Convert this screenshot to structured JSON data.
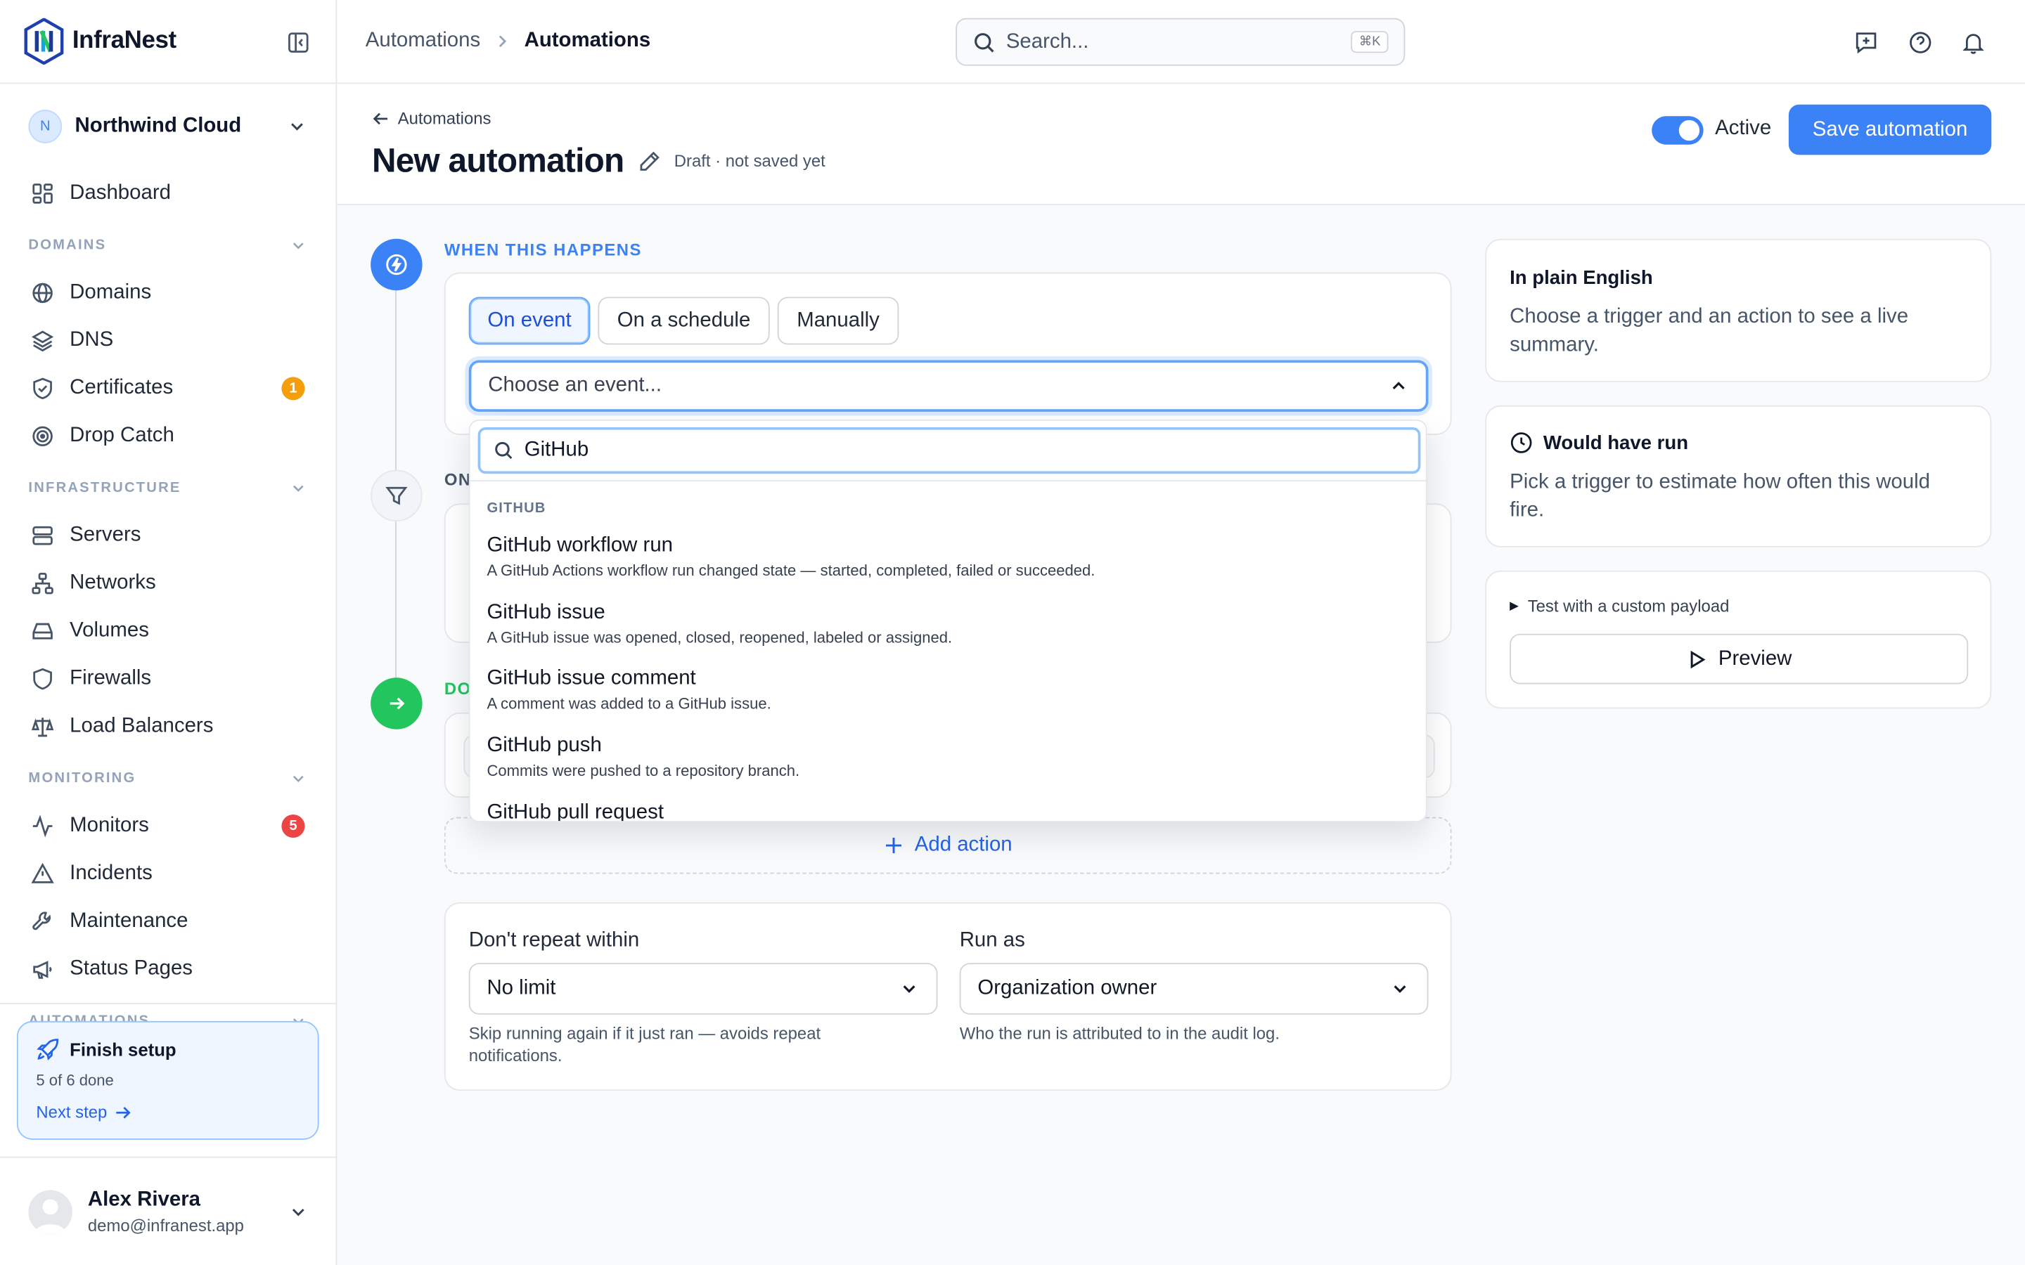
{
  "app": {
    "name": "InfraNest"
  },
  "org": {
    "initial": "N",
    "name": "Northwind Cloud"
  },
  "nav": {
    "dashboard": "Dashboard",
    "sections": {
      "domains": "DOMAINS",
      "infrastructure": "INFRASTRUCTURE",
      "monitoring": "MONITORING",
      "automations": "AUTOMATIONS"
    },
    "items": {
      "domains": "Domains",
      "dns": "DNS",
      "certificates": "Certificates",
      "certificates_badge": "1",
      "drop_catch": "Drop Catch",
      "servers": "Servers",
      "networks": "Networks",
      "volumes": "Volumes",
      "firewalls": "Firewalls",
      "load_balancers": "Load Balancers",
      "monitors": "Monitors",
      "monitors_badge": "5",
      "incidents": "Incidents",
      "maintenance": "Maintenance",
      "status_pages": "Status Pages"
    }
  },
  "setup": {
    "title": "Finish setup",
    "progress": "5 of 6 done",
    "next": "Next step"
  },
  "user": {
    "name": "Alex Rivera",
    "email": "demo@infranest.app"
  },
  "topbar": {
    "breadcrumb": [
      "Automations",
      "Automations"
    ],
    "search_placeholder": "Search...",
    "search_shortcut": "⌘K"
  },
  "header": {
    "back": "Automations",
    "title": "New automation",
    "draft": "Draft · not saved yet",
    "active_label": "Active",
    "active": true,
    "save": "Save automation"
  },
  "trigger": {
    "step_label": "WHEN THIS HAPPENS",
    "tabs": [
      "On event",
      "On a schedule",
      "Manually"
    ],
    "selected_tab": "On event",
    "event_placeholder": "Choose an event...",
    "dropdown": {
      "search_value": "GitHub",
      "group": "GITHUB",
      "items": [
        {
          "title": "GitHub workflow run",
          "desc": "A GitHub Actions workflow run changed state — started, completed, failed or succeeded."
        },
        {
          "title": "GitHub issue",
          "desc": "A GitHub issue was opened, closed, reopened, labeled or assigned."
        },
        {
          "title": "GitHub issue comment",
          "desc": "A comment was added to a GitHub issue."
        },
        {
          "title": "GitHub push",
          "desc": "Commits were pushed to a repository branch."
        },
        {
          "title": "GitHub pull request",
          "desc": ""
        }
      ]
    }
  },
  "filter": {
    "step_label": "ON"
  },
  "action": {
    "step_label": "DO",
    "add": "Add action"
  },
  "options": {
    "repeat_label": "Don't repeat within",
    "repeat_value": "No limit",
    "repeat_help": "Skip running again if it just ran — avoids repeat notifications.",
    "runas_label": "Run as",
    "runas_value": "Organization owner",
    "runas_help": "Who the run is attributed to in the audit log."
  },
  "side": {
    "summary_title": "In plain English",
    "summary_text": "Choose a trigger and an action to see a live summary.",
    "would_title": "Would have run",
    "would_text": "Pick a trigger to estimate how often this would fire.",
    "test_label": "Test with a custom payload",
    "preview": "Preview"
  },
  "colors": {
    "accent": "#3b82f6",
    "success": "#22c55e",
    "warning": "#f59e0b",
    "danger": "#ef4444"
  }
}
